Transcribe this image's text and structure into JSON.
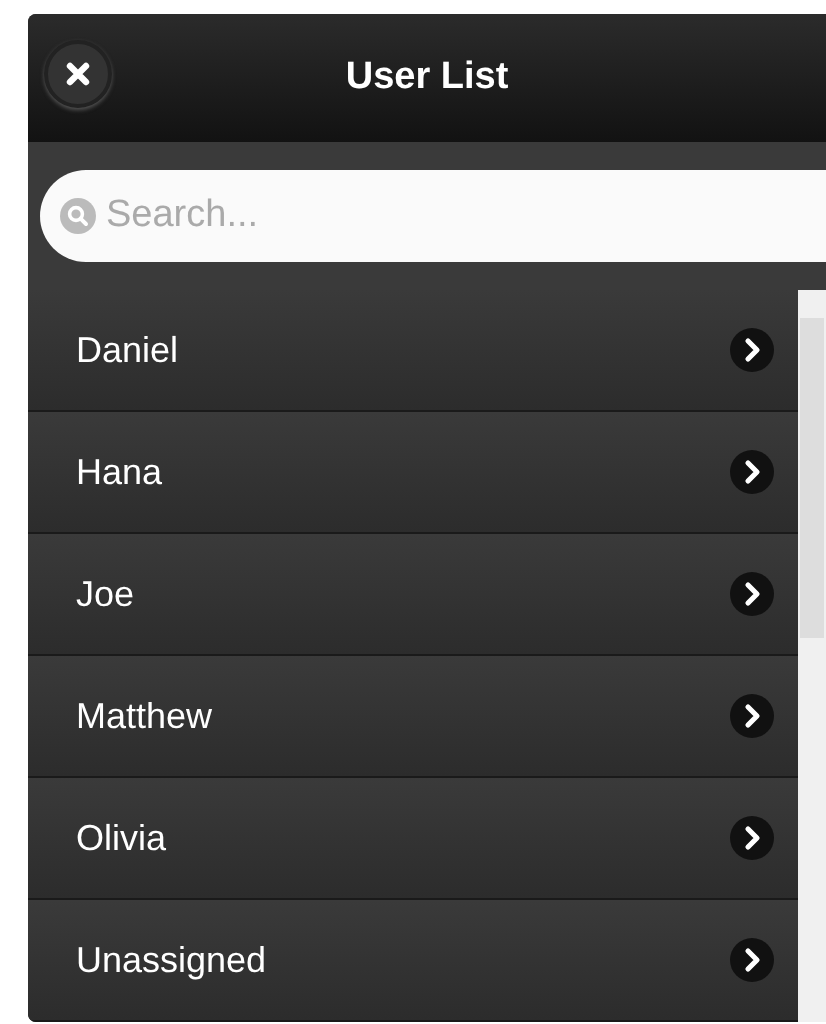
{
  "header": {
    "title": "User List"
  },
  "search": {
    "placeholder": "Search..."
  },
  "users": [
    {
      "name": "Daniel"
    },
    {
      "name": "Hana"
    },
    {
      "name": "Joe"
    },
    {
      "name": "Matthew"
    },
    {
      "name": "Olivia"
    },
    {
      "name": "Unassigned"
    }
  ]
}
